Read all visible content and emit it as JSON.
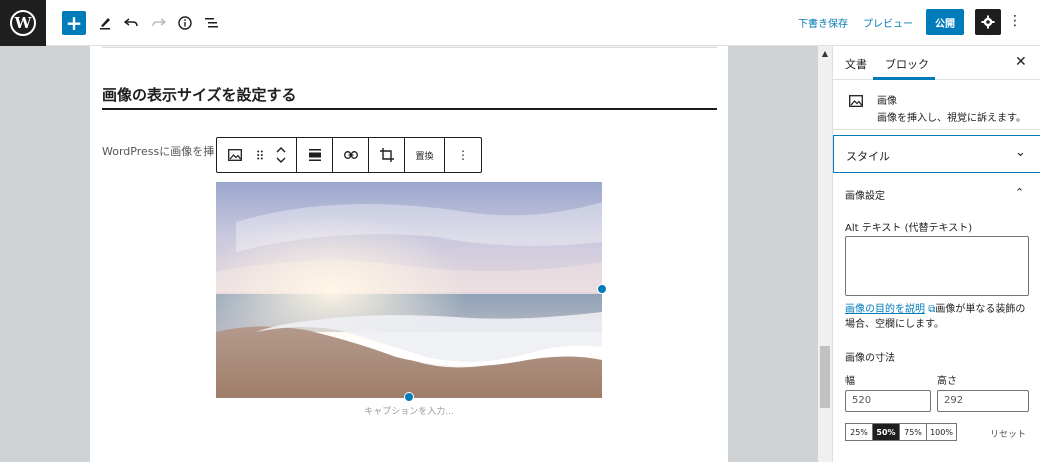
{
  "topbar": {
    "add": "+",
    "draft": "下書き保存",
    "preview": "プレビュー",
    "publish": "公開"
  },
  "editor": {
    "heading": "画像の表示サイズを設定する",
    "paragraph": "WordPressに画像を挿",
    "toolbar_replace": "置換",
    "caption_placeholder": "キャプションを入力..."
  },
  "sidebar": {
    "tabs": {
      "document": "文書",
      "block": "ブロック"
    },
    "block_title": "画像",
    "block_desc": "画像を挿入し、視覚に訴えます。",
    "styles": "スタイル",
    "image_settings": "画像設定",
    "alt_label": "Alt テキスト (代替テキスト)",
    "alt_help_link": "画像の目的を説明",
    "alt_help_line1": "画像が単なる装飾の",
    "alt_help_line2": "場合、空欄にします。",
    "dimensions_title": "画像の寸法",
    "width_label": "幅",
    "height_label": "高さ",
    "width_value": "520",
    "height_value": "292",
    "presets": [
      "25%",
      "50%",
      "75%",
      "100%"
    ],
    "reset": "リセット"
  },
  "colors": {
    "accent": "#007cba",
    "dark": "#1e1e1e"
  }
}
